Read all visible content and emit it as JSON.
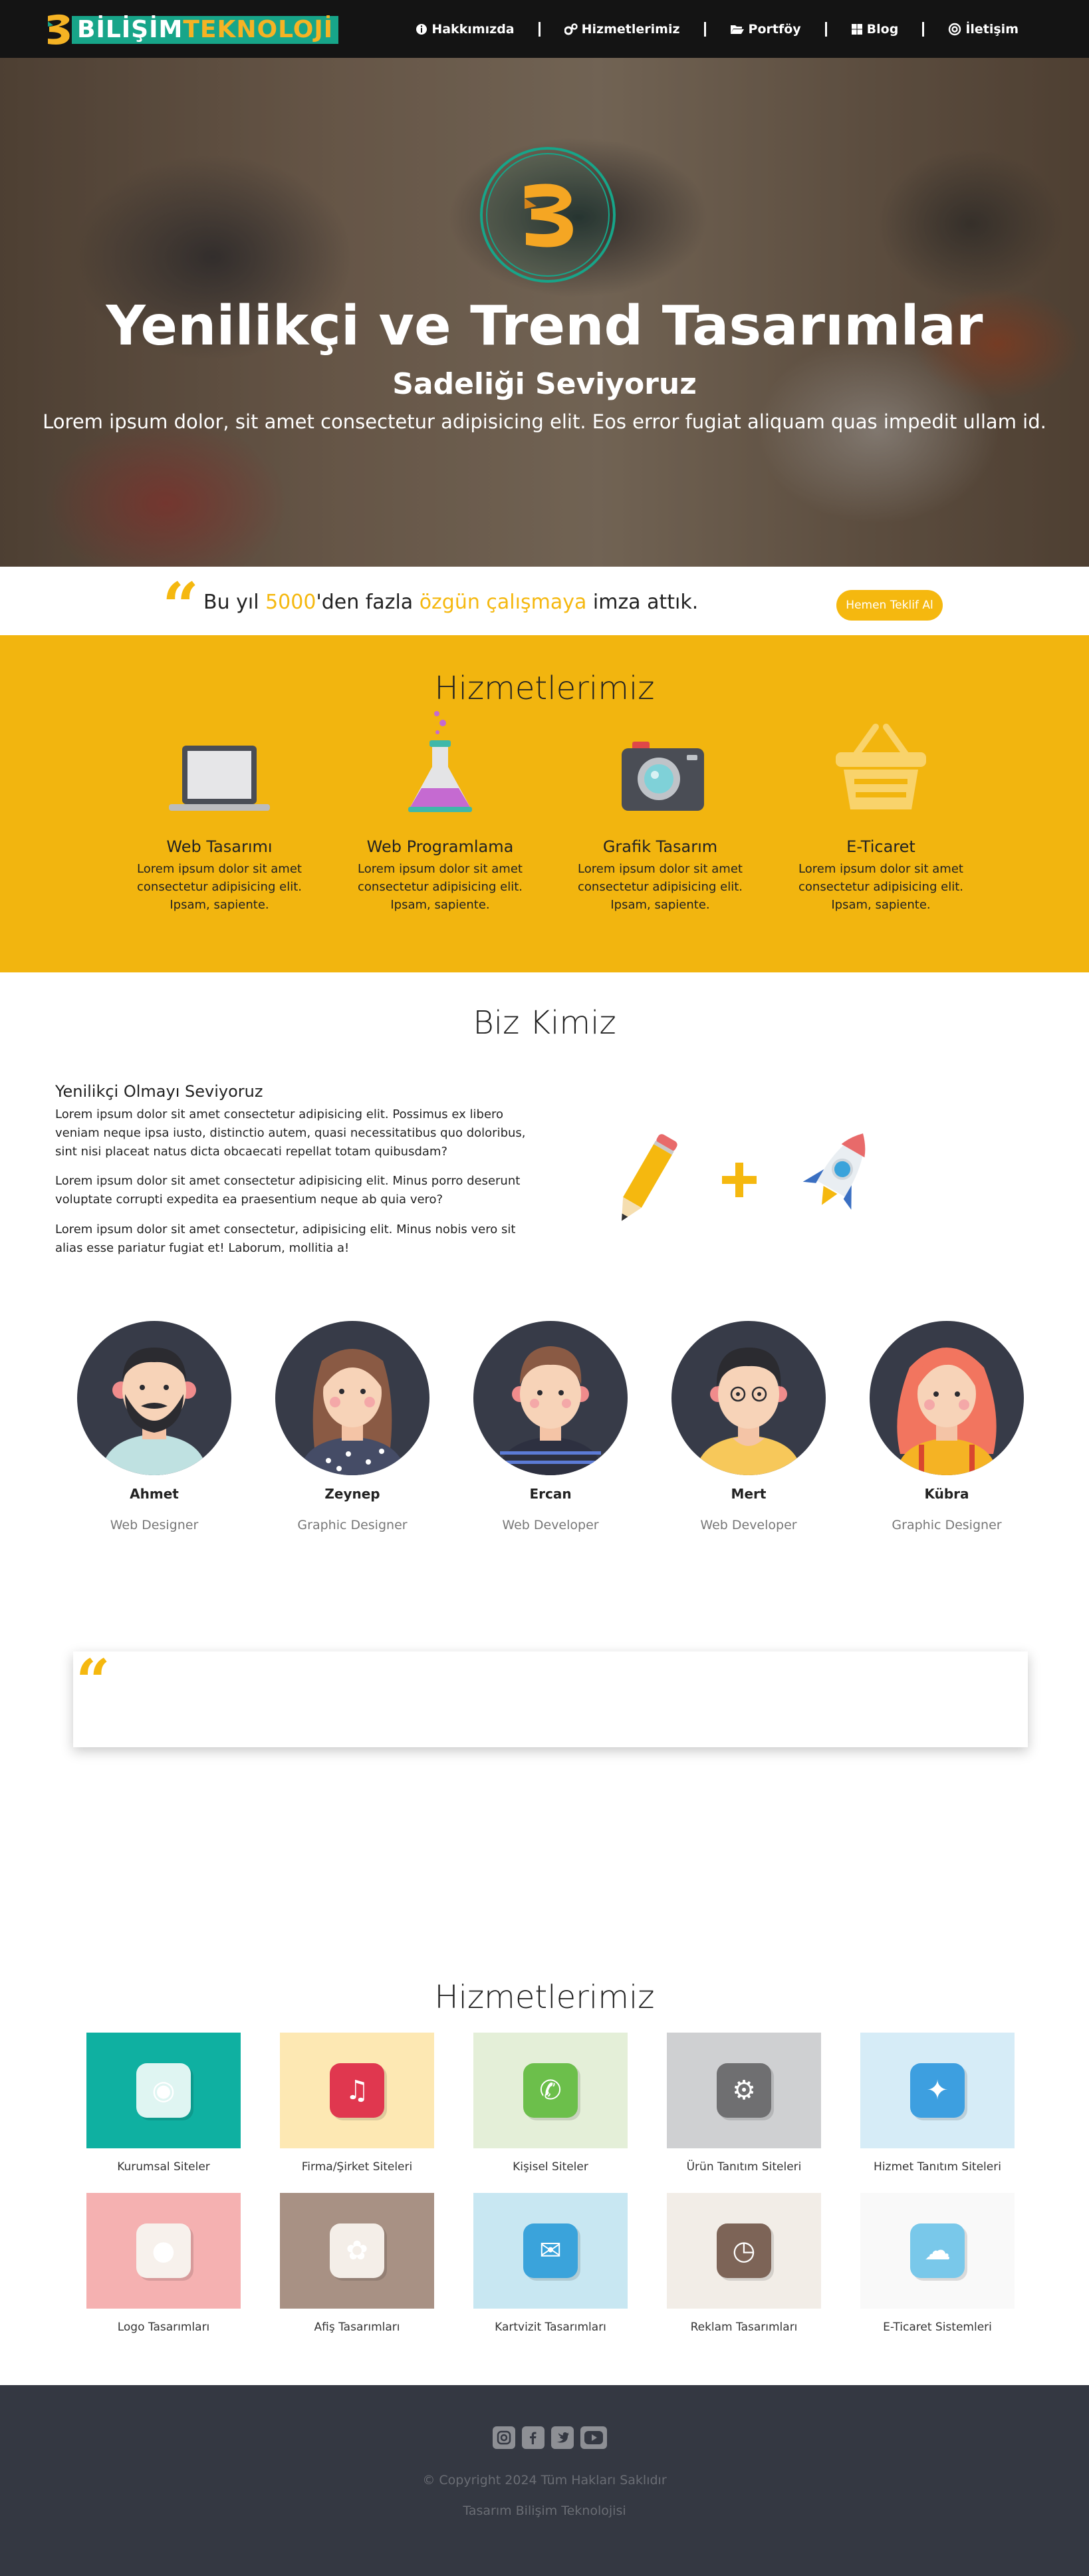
{
  "nav": {
    "logo_word1": "BİLİŞİM",
    "logo_word2": "TEKNOLOJİ",
    "items": [
      {
        "label": "Hakkımızda",
        "icon": "info-circle-icon"
      },
      {
        "label": "Hizmetlerimiz",
        "icon": "cogs-icon"
      },
      {
        "label": "Portföy",
        "icon": "folder-open-icon"
      },
      {
        "label": "Blog",
        "icon": "windows-icon"
      },
      {
        "label": "İletişim",
        "icon": "at-icon"
      }
    ]
  },
  "hero": {
    "title": "Yenilikçi ve Trend Tasarımlar",
    "subtitle": "Sadeliği Seviyoruz",
    "text": "Lorem ipsum dolor, sit amet consectetur adipisicing elit. Eos error fugiat aliquam quas impedit ullam id."
  },
  "quote_bar": {
    "text_before": "Bu yıl ",
    "highlight_number": "5000",
    "text_middle": "'den fazla ",
    "highlight_phrase": "özgün çalışmaya",
    "text_after": " imza attık.",
    "button_label": "Hemen Teklif Al"
  },
  "services_yellow": {
    "title": "Hizmetlerimiz",
    "items": [
      {
        "name": "Web Tasarımı",
        "desc": "Lorem ipsum dolor sit amet consectetur adipisicing elit. Ipsam, sapiente.",
        "icon": "laptop-icon"
      },
      {
        "name": "Web Programlama",
        "desc": "Lorem ipsum dolor sit amet consectetur adipisicing elit. Ipsam, sapiente.",
        "icon": "flask-icon"
      },
      {
        "name": "Grafik Tasarım",
        "desc": "Lorem ipsum dolor sit amet consectetur adipisicing elit. Ipsam, sapiente.",
        "icon": "camera-icon"
      },
      {
        "name": "E-Ticaret",
        "desc": "Lorem ipsum dolor sit amet consectetur adipisicing elit. Ipsam, sapiente.",
        "icon": "basket-icon"
      }
    ]
  },
  "about": {
    "title": "Biz Kimiz",
    "heading": "Yenilikçi Olmayı Seviyoruz",
    "paragraphs": [
      "Lorem ipsum dolor sit amet consectetur adipisicing elit. Possimus ex libero veniam neque ipsa iusto, distinctio autem, quasi necessitatibus quo doloribus, sint nisi placeat natus dicta obcaecati repellat totam quibusdam?",
      "Lorem ipsum dolor sit amet consectetur adipisicing elit. Minus porro deserunt voluptate corrupti expedita ea praesentium neque ab quia vero?",
      "Lorem ipsum dolor sit amet consectetur, adipisicing elit. Minus nobis vero sit alias esse pariatur fugiat et! Laborum, mollitia a!"
    ]
  },
  "team": [
    {
      "name": "Ahmet",
      "role": "Web Designer"
    },
    {
      "name": "Zeynep",
      "role": "Graphic Designer"
    },
    {
      "name": "Ercan",
      "role": "Web Developer"
    },
    {
      "name": "Mert",
      "role": "Web Developer"
    },
    {
      "name": "Kübra",
      "role": "Graphic Designer"
    }
  ],
  "services_grid": {
    "title": "Hizmetlerimiz",
    "tiles": [
      {
        "label": "Kurumsal Siteler",
        "bg": "#0fb0a1",
        "icon_bg": "#dff5f2",
        "icon": "camera-app-icon"
      },
      {
        "label": "Firma/Şirket Siteleri",
        "bg": "#fde8b3",
        "icon_bg": "#e0374f",
        "icon": "music-note-icon"
      },
      {
        "label": "Kişisel Siteler",
        "bg": "#e4efd8",
        "icon_bg": "#6cbf4b",
        "icon": "phone-icon"
      },
      {
        "label": "Ürün Tanıtım Siteleri",
        "bg": "#cfd0d2",
        "icon_bg": "#6f6f71",
        "icon": "settings-gear-icon"
      },
      {
        "label": "Hizmet Tanıtım Siteleri",
        "bg": "#d6ecf7",
        "icon_bg": "#3d9fe0",
        "icon": "compass-icon"
      },
      {
        "label": "Logo Tasarımları",
        "bg": "#f5b1b1",
        "icon_bg": "#f7f1ec",
        "icon": "chat-bubbles-icon"
      },
      {
        "label": "Afiş Tasarımları",
        "bg": "#a89184",
        "icon_bg": "#f4eee8",
        "icon": "photos-flower-icon"
      },
      {
        "label": "Kartvizit Tasarımları",
        "bg": "#c8e7f2",
        "icon_bg": "#3aa3db",
        "icon": "mail-icon"
      },
      {
        "label": "Reklam Tasarımları",
        "bg": "#f2ede7",
        "icon_bg": "#7d6457",
        "icon": "clock-icon"
      },
      {
        "label": "E-Ticaret Sistemleri",
        "bg": "#f9f9f9",
        "icon_bg": "#79c8ea",
        "icon": "weather-icon"
      }
    ]
  },
  "footer": {
    "social_icons": [
      "instagram-icon",
      "facebook-icon",
      "twitter-icon",
      "youtube-icon"
    ],
    "copyright": "© Copyright 2024 Tüm Hakları Saklıdır",
    "credit": "Tasarım Bilişim Teknolojisi"
  }
}
